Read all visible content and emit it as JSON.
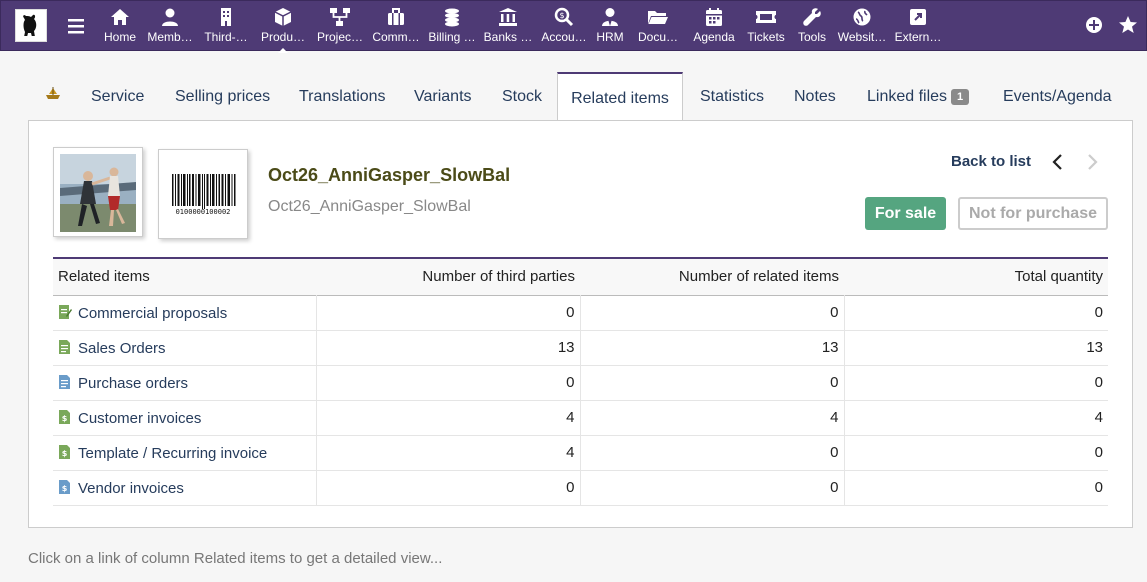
{
  "topnav": {
    "items": [
      {
        "label": "Home",
        "icon": "home-icon"
      },
      {
        "label": "Memb…",
        "icon": "user-icon"
      },
      {
        "label": "Third-…",
        "icon": "building-icon"
      },
      {
        "label": "Produ…",
        "icon": "cube-icon"
      },
      {
        "label": "Projec…",
        "icon": "sitemap-icon"
      },
      {
        "label": "Comm…",
        "icon": "briefcase-icon"
      },
      {
        "label": "Billing …",
        "icon": "coins-icon"
      },
      {
        "label": "Banks …",
        "icon": "bank-icon"
      },
      {
        "label": "Accou…",
        "icon": "search-dollar-icon"
      },
      {
        "label": "HRM",
        "icon": "user-tie-icon"
      },
      {
        "label": "Docu…",
        "icon": "folder-icon"
      },
      {
        "label": "Agenda",
        "icon": "calendar-icon"
      },
      {
        "label": "Tickets",
        "icon": "ticket-icon"
      },
      {
        "label": "Tools",
        "icon": "wrench-icon"
      },
      {
        "label": "Websit…",
        "icon": "globe-icon"
      },
      {
        "label": "Extern…",
        "icon": "external-link-icon"
      }
    ],
    "active_index": 3,
    "accent_color": "#4e3a75"
  },
  "tabs": [
    {
      "label": "Service"
    },
    {
      "label": "Selling prices"
    },
    {
      "label": "Translations"
    },
    {
      "label": "Variants"
    },
    {
      "label": "Stock"
    },
    {
      "label": "Related items"
    },
    {
      "label": "Statistics"
    },
    {
      "label": "Notes"
    },
    {
      "label": "Linked files",
      "badge": "1"
    },
    {
      "label": "Events/Agenda"
    }
  ],
  "product": {
    "ref": "Oct26_AnniGasper_SlowBal",
    "label": "Oct26_AnniGasper_SlowBal",
    "barcode_text": "0100000100002",
    "back_to_list": "Back to list",
    "status_sale": "For sale",
    "status_purchase": "Not for purchase",
    "sale_color": "#55a580"
  },
  "table": {
    "headers": [
      "Related items",
      "Number of third parties",
      "Number of related items",
      "Total quantity"
    ],
    "rows": [
      {
        "label": "Commercial proposals",
        "icon": "proposal-icon",
        "third_parties": "0",
        "related_items": "0",
        "total_qty": "0"
      },
      {
        "label": "Sales Orders",
        "icon": "order-icon",
        "third_parties": "13",
        "related_items": "13",
        "total_qty": "13"
      },
      {
        "label": "Purchase orders",
        "icon": "supplier-order-icon",
        "third_parties": "0",
        "related_items": "0",
        "total_qty": "0"
      },
      {
        "label": "Customer invoices",
        "icon": "invoice-icon",
        "third_parties": "4",
        "related_items": "4",
        "total_qty": "4"
      },
      {
        "label": "Template / Recurring invoice",
        "icon": "recurring-invoice-icon",
        "third_parties": "4",
        "related_items": "0",
        "total_qty": "0"
      },
      {
        "label": "Vendor invoices",
        "icon": "supplier-invoice-icon",
        "third_parties": "0",
        "related_items": "0",
        "total_qty": "0"
      }
    ]
  },
  "footer_hint": "Click on a link of column Related items to get a detailed view..."
}
